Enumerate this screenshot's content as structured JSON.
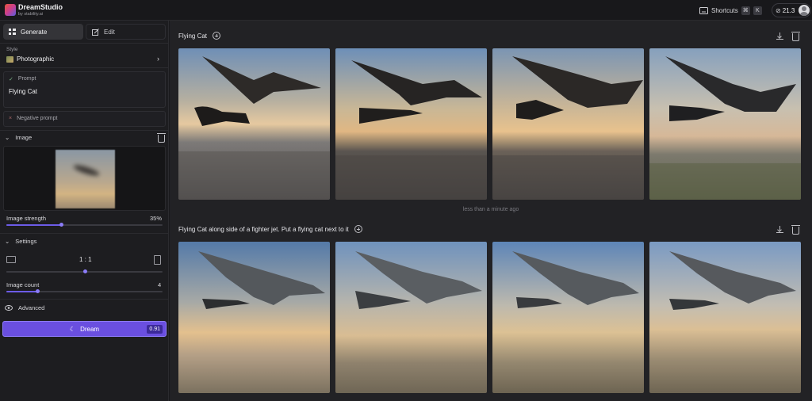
{
  "app": {
    "name": "DreamStudio",
    "subtitle": "by stability.ai"
  },
  "topbar": {
    "shortcuts_label": "Shortcuts",
    "shortcut_keys": [
      "⌘",
      "K"
    ],
    "credits": "21.3"
  },
  "sidebar": {
    "tabs": [
      {
        "label": "Generate",
        "icon": "grid-icon"
      },
      {
        "label": "Edit",
        "icon": "edit-icon"
      }
    ],
    "style": {
      "label": "Style",
      "value": "Photographic"
    },
    "prompt": {
      "label": "Prompt",
      "value": "Flying Cat"
    },
    "negative_prompt": {
      "label": "Negative prompt"
    },
    "image": {
      "label": "Image"
    },
    "image_strength": {
      "label": "Image strength",
      "value": "35%",
      "fraction": 0.35
    },
    "settings": {
      "label": "Settings"
    },
    "aspect_ratio": {
      "value": "1 : 1",
      "fraction": 0.5
    },
    "image_count": {
      "label": "Image count",
      "value": "4",
      "fraction": 0.2
    },
    "advanced": {
      "label": "Advanced"
    },
    "dream": {
      "label": "Dream",
      "cost": "0.91"
    }
  },
  "main": {
    "groups": [
      {
        "title": "Flying Cat",
        "images": [
          "sky1",
          "sky2",
          "sky3",
          "sky4"
        ],
        "timestamp": "less than a minute ago"
      },
      {
        "title": "Flying Cat along side of a fighter jet. Put a flying cat next to it",
        "images": [
          "jet1",
          "jet2",
          "jet3",
          "jet4"
        ]
      }
    ]
  },
  "colors": {
    "accent": "#6a4fe0",
    "background": "#1a1a1c"
  }
}
